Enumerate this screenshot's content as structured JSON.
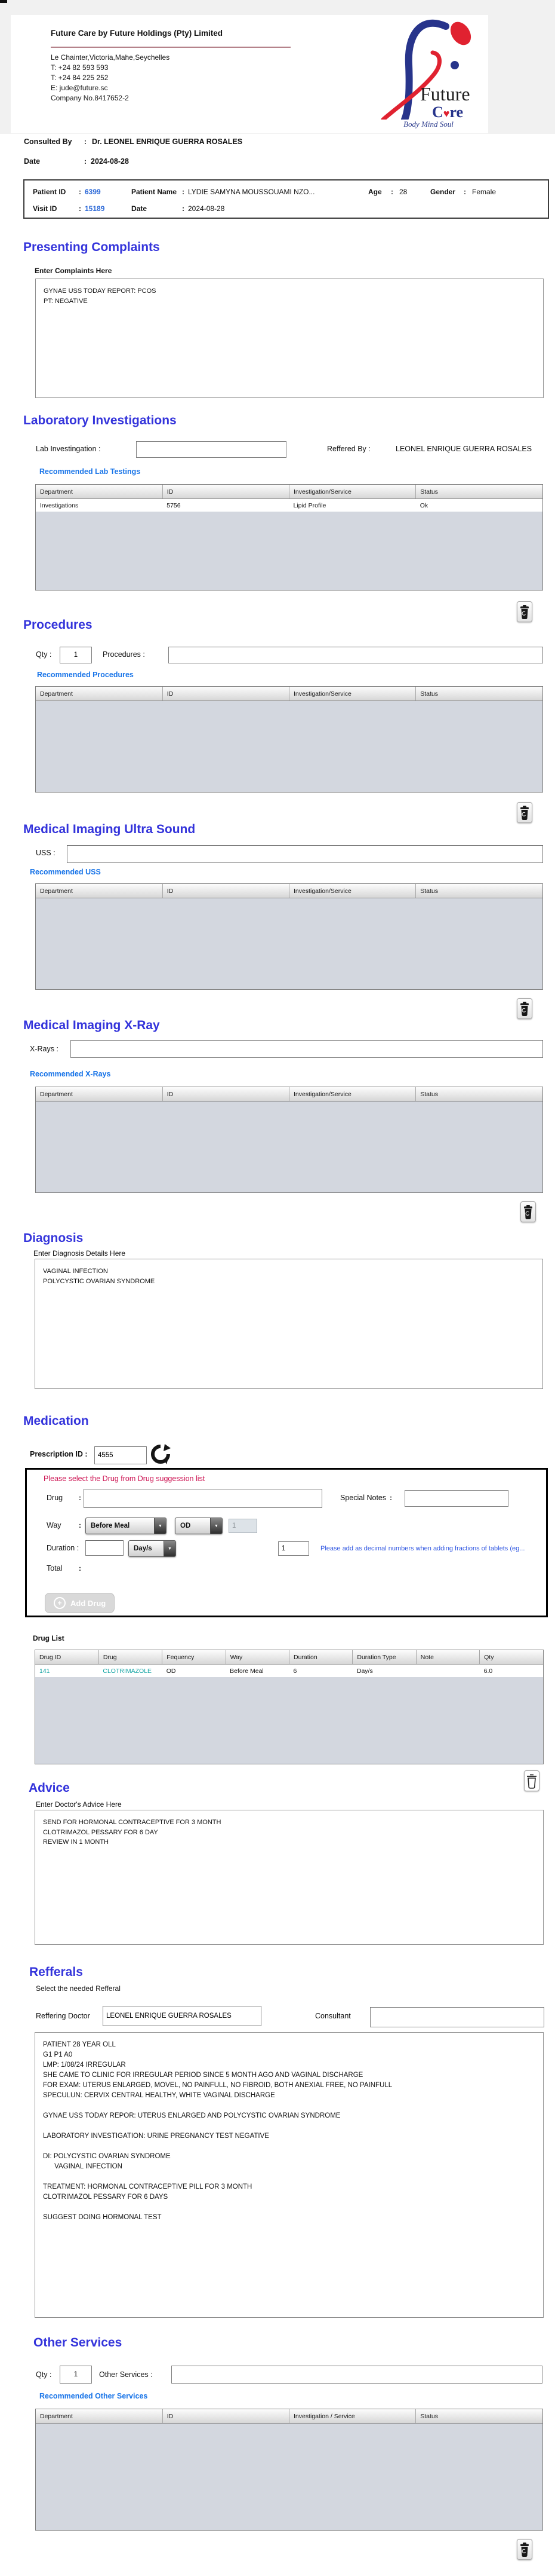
{
  "ui": {
    "colon": ":",
    "icons": {
      "plus": "+",
      "dropdown_arrow": "▼"
    }
  },
  "colors": {
    "heading_blue": "#3434db",
    "link_blue": "#1874e8",
    "id_blue": "#2f6bd8",
    "alert_crimson": "#cc1050",
    "drug_teal": "#11a3a3",
    "table_body_grey": "#d3d7df"
  },
  "letterhead": {
    "company": "Future Care by Future Holdings (Pty) Limited",
    "address": "Le Chainter,Victoria,Mahe,Seychelles",
    "phone1": "T: +24  82 593 593",
    "phone2": "T: +24  84 225 252",
    "email": "E: jude@future.sc",
    "company_no": "Company No.8417652-2",
    "logo_word1": "Future",
    "logo_word2": "C",
    "logo_word2b": "re",
    "logo_heart": "♥",
    "tagline": "Body Mind Soul"
  },
  "consult": {
    "consulted_by_label": "Consulted By",
    "consulted_by_value": "Dr.  LEONEL ENRIQUE GUERRA ROSALES",
    "date_label": "Date",
    "date_value": "2024-08-28"
  },
  "patient_bar": {
    "patient_id_label": "Patient ID",
    "patient_id": "6399",
    "patient_name_label": "Patient Name",
    "patient_name": "LYDIE SAMYNA MOUSSOUAMI NZO...",
    "age_label": "Age",
    "age": "28",
    "gender_label": "Gender",
    "gender": "Female",
    "visit_id_label": "Visit ID",
    "visit_id": "15189",
    "visit_date_label": "Date",
    "visit_date": "2024-08-28"
  },
  "presenting": {
    "title": "Presenting Complaints",
    "entry_label": "Enter Complaints Here",
    "text": "GYNAE USS TODAY REPORT: PCOS\nPT: NEGATIVE"
  },
  "lab": {
    "title": "Laboratory  Investigations",
    "field_label": "Lab Investingation :",
    "reffered_label": "Reffered By :",
    "reffered_value": "LEONEL ENRIQUE GUERRA ROSALES",
    "recommended": "Recommended Lab Testings",
    "table": {
      "headers": [
        "Department",
        "ID",
        "Investigation/Service",
        "Status"
      ],
      "rows": [
        [
          "Investigations",
          "5756",
          "Lipid Profile",
          "Ok"
        ]
      ]
    }
  },
  "procedures": {
    "title": "Procedures",
    "qty_label": "Qty :",
    "qty_value": "1",
    "field_label": "Procedures :",
    "recommended": "Recommended Procedures",
    "table": {
      "headers": [
        "Department",
        "ID",
        "Investigation/Service",
        "Status"
      ],
      "rows": []
    }
  },
  "uss": {
    "title": "Medical Imaging Ultra Sound",
    "field_label": "USS :",
    "recommended": "Recommended USS",
    "table": {
      "headers": [
        "Department",
        "ID",
        "Investigation/Service",
        "Status"
      ],
      "rows": []
    }
  },
  "xray": {
    "title": "Medical Imaging X-Ray",
    "field_label": "X-Rays :",
    "recommended": "Recommended X-Rays",
    "table": {
      "headers": [
        "Department",
        "ID",
        "Investigation/Service",
        "Status"
      ],
      "rows": []
    }
  },
  "diagnosis": {
    "title": "Diagnosis",
    "entry_label": "Enter Diagnosis Details Here",
    "text": "VAGINAL INFECTION\nPOLYCYSTIC OVARIAN SYNDROME"
  },
  "medication": {
    "title": "Medication",
    "prescription_label": "Prescription ID :",
    "prescription_id": "4555",
    "hint": "Please select the Drug from Drug suggession list",
    "drug_label": "Drug",
    "special_notes_label": "Special Notes",
    "way_label": "Way",
    "way_select1": "Before Meal",
    "way_select2": "OD",
    "way_qty": "1",
    "duration_label": "Duration :",
    "duration_select": "Day/s",
    "dose_value": "1",
    "decimal_hint": "Please add as decimal numbers when adding fractions of tablets (eg...",
    "total_label": "Total",
    "add_drug_label": "Add Drug",
    "drug_list_label": "Drug List",
    "table": {
      "headers": [
        "Drug ID",
        "Drug",
        "Fequency",
        "Way",
        "Duration",
        "Duration Type",
        "Note",
        "Qty"
      ],
      "rows": [
        [
          "141",
          "CLOTRIMAZOLE",
          "OD",
          "Before Meal",
          "6",
          "Day/s",
          "",
          "6.0"
        ]
      ]
    }
  },
  "advice": {
    "title": "Advice",
    "entry_label": "Enter Doctor's Advice Here",
    "text": "SEND FOR HORMONAL CONTRACEPTIVE FOR 3 MONTH\nCLOTRIMAZOL PESSARY FOR 6 DAY\nREVIEW IN 1 MONTH"
  },
  "referrals": {
    "title": "Refferals",
    "subtitle": "Select the needed Refferal",
    "reffering_label": "Reffering Doctor",
    "reffering_value": "LEONEL ENRIQUE GUERRA ROSALES",
    "consultant_label": "Consultant",
    "text": "PATIENT 28 YEAR OLL\nG1 P1 A0\nLMP: 1/08/24 IRREGULAR\nSHE CAME TO CLINIC FOR IRREGULAR PERIOD SINCE 5 MONTH AGO AND VAGINAL DISCHARGE\nFOR EXAM: UTERUS ENLARGED, MOVEL, NO PAINFULL, NO FIBROID, BOTH ANEXIAL FREE, NO PAINFULL\nSPECULUN: CERVIX CENTRAL HEALTHY, WHITE VAGINAL DISCHARGE\n\nGYNAE USS TODAY REPOR: UTERUS ENLARGED AND POLYCYSTIC OVARIAN SYNDROME\n\nLABORATORY INVESTIGATION: URINE PREGNANCY TEST NEGATIVE\n\nDI: POLYCYSTIC OVARIAN SYNDROME\n      VAGINAL INFECTION\n\nTREATMENT: HORMONAL CONTRACEPTIVE PILL FOR 3 MONTH\nCLOTRIMAZOL PESSARY FOR 6 DAYS\n\nSUGGEST DOING HORMONAL TEST"
  },
  "other": {
    "title": "Other Services",
    "qty_label": "Qty :",
    "qty_value": "1",
    "field_label": "Other Services :",
    "recommended": "Recommended Other Services",
    "table": {
      "headers": [
        "Department",
        "ID",
        "Investigation / Service",
        "Status"
      ],
      "rows": []
    }
  }
}
